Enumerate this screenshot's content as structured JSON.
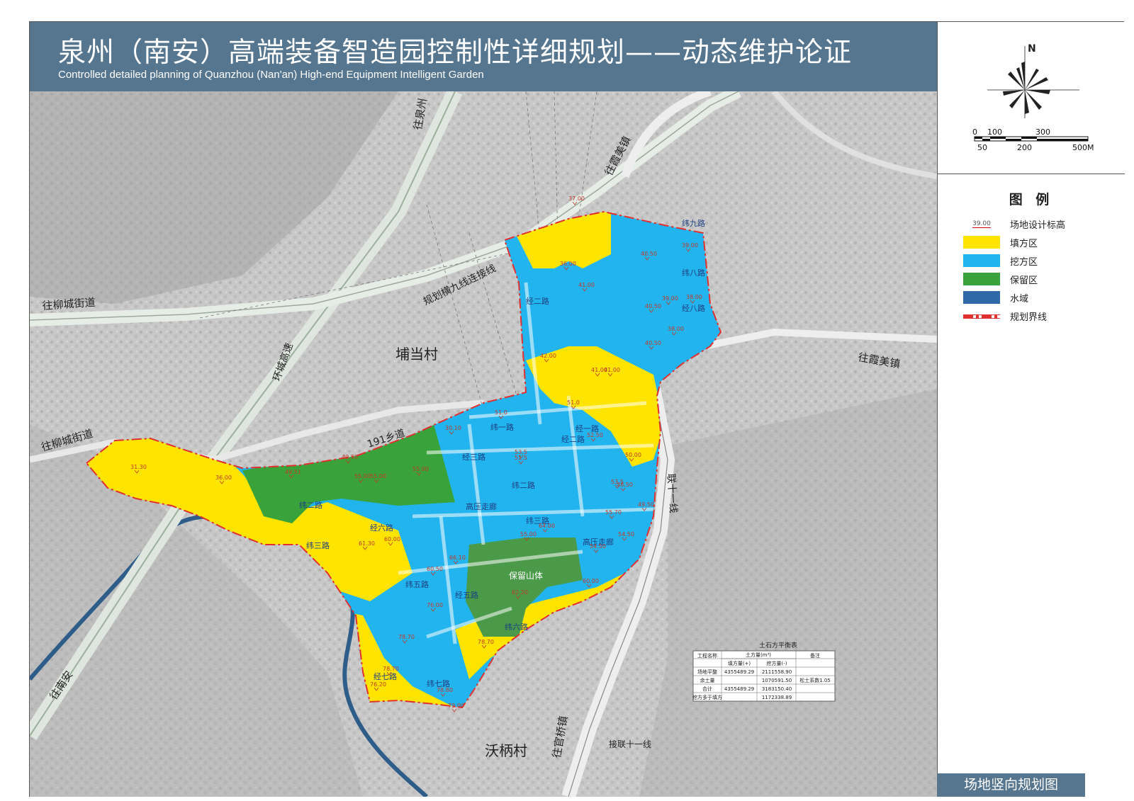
{
  "header": {
    "title": "泉州（南安）高端装备智造园控制性详细规划——动态维护论证",
    "subtitle": "Controlled detailed planning of Quanzhou (Nan'an) High-end Equipment Intelligent Garden"
  },
  "north_label": "N",
  "scale": {
    "top_labels": [
      "0",
      "100",
      "300"
    ],
    "bottom_labels": [
      "50",
      "200",
      "500M"
    ]
  },
  "legend": {
    "title": "图 例",
    "items": [
      {
        "symbol": "39.00",
        "label": "场地设计标高"
      },
      {
        "label": "填方区",
        "color": "#ffe400"
      },
      {
        "label": "挖方区",
        "color": "#22b4ee"
      },
      {
        "label": "保留区",
        "color": "#3aa23a"
      },
      {
        "label": "水域",
        "color": "#2f6aa6"
      },
      {
        "label": "规划界线",
        "color": "#e03030"
      }
    ]
  },
  "sheet_title": "场地竖向规划图",
  "map": {
    "places": {
      "pudang": "埔当村",
      "wobing": "沃柄村"
    },
    "directions": {
      "quanzhou": "往泉州",
      "xiamei_top": "往霞美镇",
      "xiamei_right": "往霞美镇",
      "liucheng_1": "往柳城街道",
      "liucheng_2": "往柳城街道",
      "nanan": "往南安",
      "guanqiao": "往官桥镇"
    },
    "roads": {
      "hengjiu": "规划横九线连接线",
      "huancheng": "环城高速",
      "xiangdao": "191乡道",
      "lian11": "联十一线",
      "jie11": "接联十一线",
      "wei1": "纬一路",
      "wei2a": "纬二路",
      "wei2b": "纬二路",
      "wei3a": "纬三路",
      "wei3b": "纬三路",
      "wei5": "纬五路",
      "wei6": "纬六路",
      "wei7": "纬七路",
      "wei8": "纬八路",
      "wei9": "纬九路",
      "jing1": "经一路",
      "jing2a": "经二路",
      "jing2b": "经二路",
      "jing3": "经三路",
      "jing5": "经五路",
      "jing6": "经六路",
      "jing7": "经七路",
      "jing8": "经八路",
      "gaoya1": "高压走廊",
      "gaoya2": "高压走廊",
      "reserve_mountain": "保留山体"
    },
    "elevations": [
      "37.00",
      "36.00",
      "40.50",
      "39.00",
      "40.50",
      "38.00",
      "41.00",
      "40.50",
      "39.00",
      "38.00",
      "42.00",
      "41.00",
      "41.00",
      "51.0",
      "51.0",
      "52.50",
      "50.00",
      "53.5",
      "51.5",
      "53.5",
      "48.50",
      "49.50",
      "55.70",
      "54.50",
      "64.00",
      "55.00",
      "54.50",
      "60.00",
      "60.50",
      "60.00",
      "31.30",
      "36.00",
      "49.51",
      "49.50",
      "55.00",
      "55.00",
      "55.00",
      "61.30",
      "66.10",
      "62.20",
      "76.00",
      "78.70",
      "78.70",
      "78.70",
      "76.20",
      "78.80",
      "79.00",
      "30.10"
    ],
    "balance_table": {
      "title": "土石方平衡表",
      "header1": [
        "工程名称",
        "土方量(m³)",
        "备注"
      ],
      "header2": [
        "填方量(+)",
        "挖方量(-)"
      ],
      "rows": [
        [
          "场地平整",
          "4355489.29",
          "2111558.90",
          ""
        ],
        [
          "余土量",
          "",
          "1070591.50",
          "松土系数1.05"
        ],
        [
          "合计",
          "4355489.29",
          "3183150.40",
          ""
        ],
        [
          "挖方多于填方",
          "",
          "1172338.89",
          ""
        ]
      ]
    }
  }
}
